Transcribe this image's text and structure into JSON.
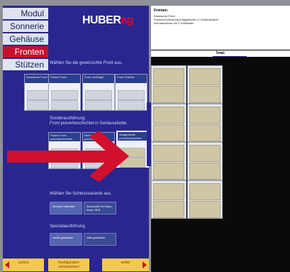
{
  "tabs": [
    "Modul",
    "Sonnerie",
    "Gehäuse",
    "Fronten",
    "Stützen"
  ],
  "prompts": {
    "front": "Wählen Sie die gewünschte Front aus.",
    "special_front_heading": "Sonderausführung:",
    "special_front_sub": "Front pulverbeschichtet in Gehäusefarbe.",
    "lock": "Wählen Sie Schlossvariante aus.",
    "special_design": "Spezialausführung."
  },
  "front_options": [
    "Klassische Front",
    "Flache Front",
    "Front mit Bügel",
    "Front Oneline"
  ],
  "special_options": [
    "Flache Front pulverbeschichtet",
    "Bandfront pulverbeschichtet",
    "Ablagefächer pulverbeschichtet"
  ],
  "lock_options": [
    "Schloss Standard",
    "Ausschnitt für Kaba, Keso, SKS"
  ],
  "hinge_options": [
    "rechts gebandet",
    "links gebandet"
  ],
  "nav": {
    "back": "zurück",
    "reset": "Konfiguration zurücksetzen",
    "next": "weiter"
  },
  "summary": {
    "title": "Fronten:",
    "lines": [
      "Klassische Front",
      "Pulverbeschichtung Ablagefächer, in Gehäusefarbe",
      "Normalschloss mit 2 Schlüsseln"
    ],
    "total_label": "Total:"
  },
  "colors": {
    "panel": "#2a268f",
    "accent": "#c8102e",
    "nav_button": "#f2c94c"
  }
}
